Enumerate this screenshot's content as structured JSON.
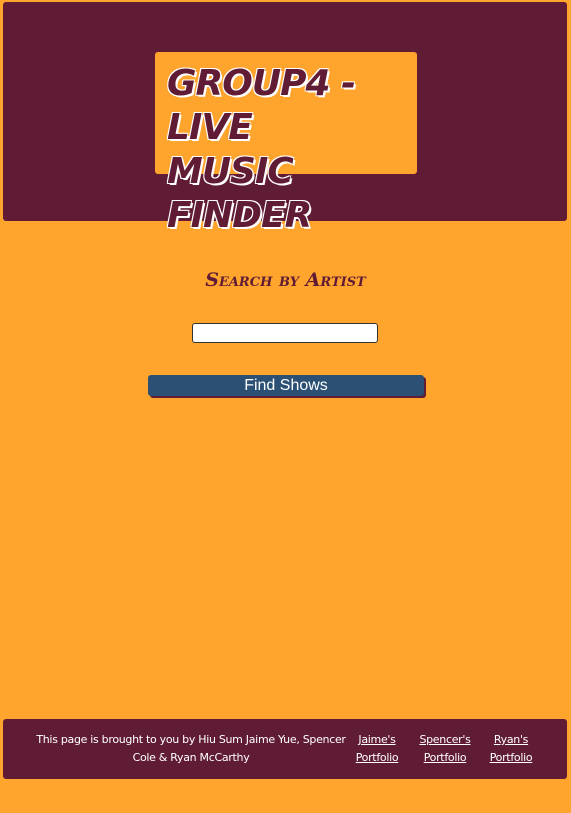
{
  "header": {
    "title_line1": "Group4 - Live",
    "title_line2": "Music Finder"
  },
  "search": {
    "heading": "Search by Artist",
    "input_value": "",
    "button_label": "Find Shows"
  },
  "footer": {
    "credit": "This page is brought to you by Hiu Sum Jaime Yue, Spencer Cole & Ryan McCarthy",
    "links": [
      {
        "line1": "Jaime's",
        "line2": "Portfolio"
      },
      {
        "line1": "Spencer's",
        "line2": "Portfolio"
      },
      {
        "line1": "Ryan's",
        "line2": "Portfolio"
      }
    ]
  },
  "colors": {
    "background": "#ffa52e",
    "header_footer": "#611c35",
    "button": "#2c4f74"
  }
}
